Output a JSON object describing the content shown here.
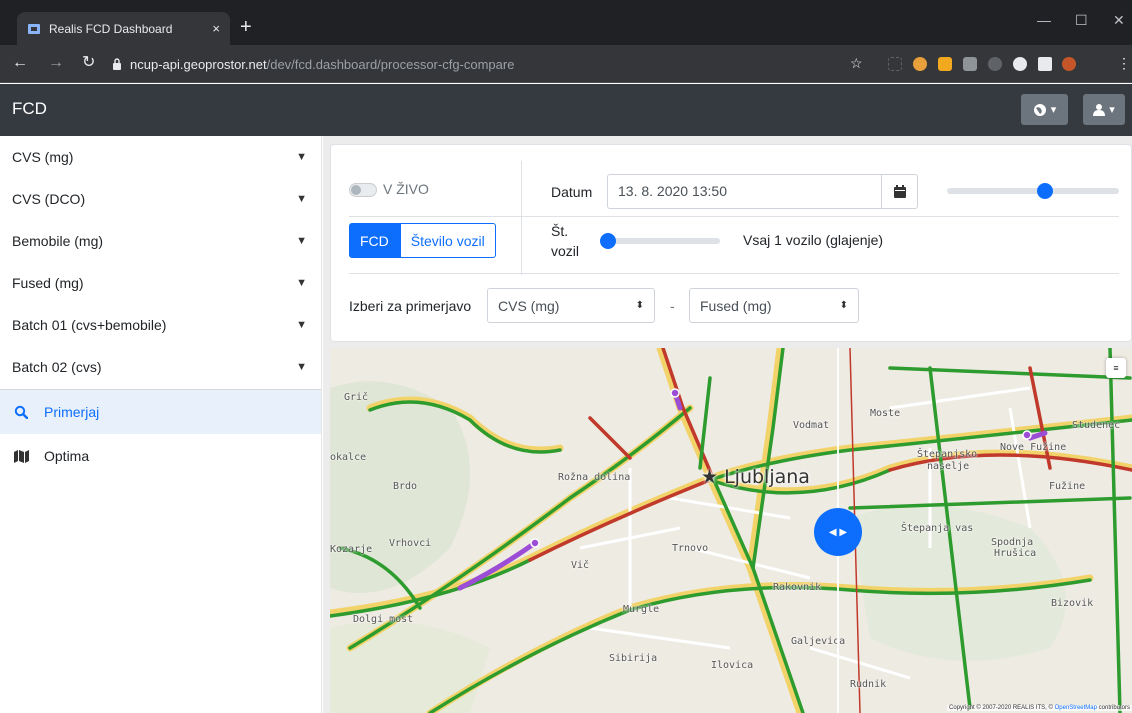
{
  "browser": {
    "tab_title": "Realis FCD Dashboard",
    "close_glyph": "×",
    "newtab_glyph": "+",
    "url_host": "ncup-api.geoprostor.net",
    "url_path": "/dev/fcd.dashboard/processor-cfg-compare"
  },
  "app": {
    "brand": "FCD"
  },
  "sidebar": {
    "groups": [
      {
        "label": "CVS (mg)"
      },
      {
        "label": "CVS (DCO)"
      },
      {
        "label": "Bemobile (mg)"
      },
      {
        "label": "Fused (mg)"
      },
      {
        "label": "Batch 01 (cvs+bemobile)"
      },
      {
        "label": "Batch 02 (cvs)"
      }
    ],
    "links": [
      {
        "label": "Primerjaj",
        "icon": "search-icon",
        "active": true
      },
      {
        "label": "Optima",
        "icon": "map-icon",
        "active": false
      }
    ]
  },
  "controls": {
    "live_label": "V ŽIVO",
    "datum_label": "Datum",
    "datum_value": "13. 8. 2020 13:50",
    "time_slider_fraction": 0.58,
    "mode_fcd": "FCD",
    "mode_count": "Število vozil",
    "count_label_line1": "Št.",
    "count_label_line2": "vozil",
    "count_slider_fraction": 0.0,
    "count_value": "Vsaj 1 vozilo (glajenje)",
    "compare_label": "Izberi za primerjavo",
    "compare_left": "CVS (mg)",
    "compare_sep": "-",
    "compare_right": "Fused (mg)"
  },
  "map": {
    "city": "Ljubljana",
    "labels": [
      "Grič",
      "Vodmat",
      "Moste",
      "Studenec",
      "Nove Fužine",
      "Štepanjsko",
      "naselje",
      "Fužine",
      "okalce",
      "Rožna dolina",
      "Brdo",
      "Štepanja vas",
      "Spodnja",
      "Hrušica",
      "Vrhovci",
      "Kozarje",
      "Trnovo",
      "Vič",
      "Rakovnik",
      "Bizovik",
      "Murgle",
      "Dolgi most",
      "Galjevica",
      "Sibirija",
      "Ilovica",
      "Rudnik"
    ],
    "copyright_text": "Copyright © 2007-2020 REALIS ITS, ©",
    "copyright_link": "OpenStreetMap",
    "copyright_tail": "contributors",
    "colors": {
      "fast": "#2e9b2e",
      "medium": "#e6b800",
      "slow": "#c0392b",
      "compare": "#9b4dd6"
    }
  }
}
